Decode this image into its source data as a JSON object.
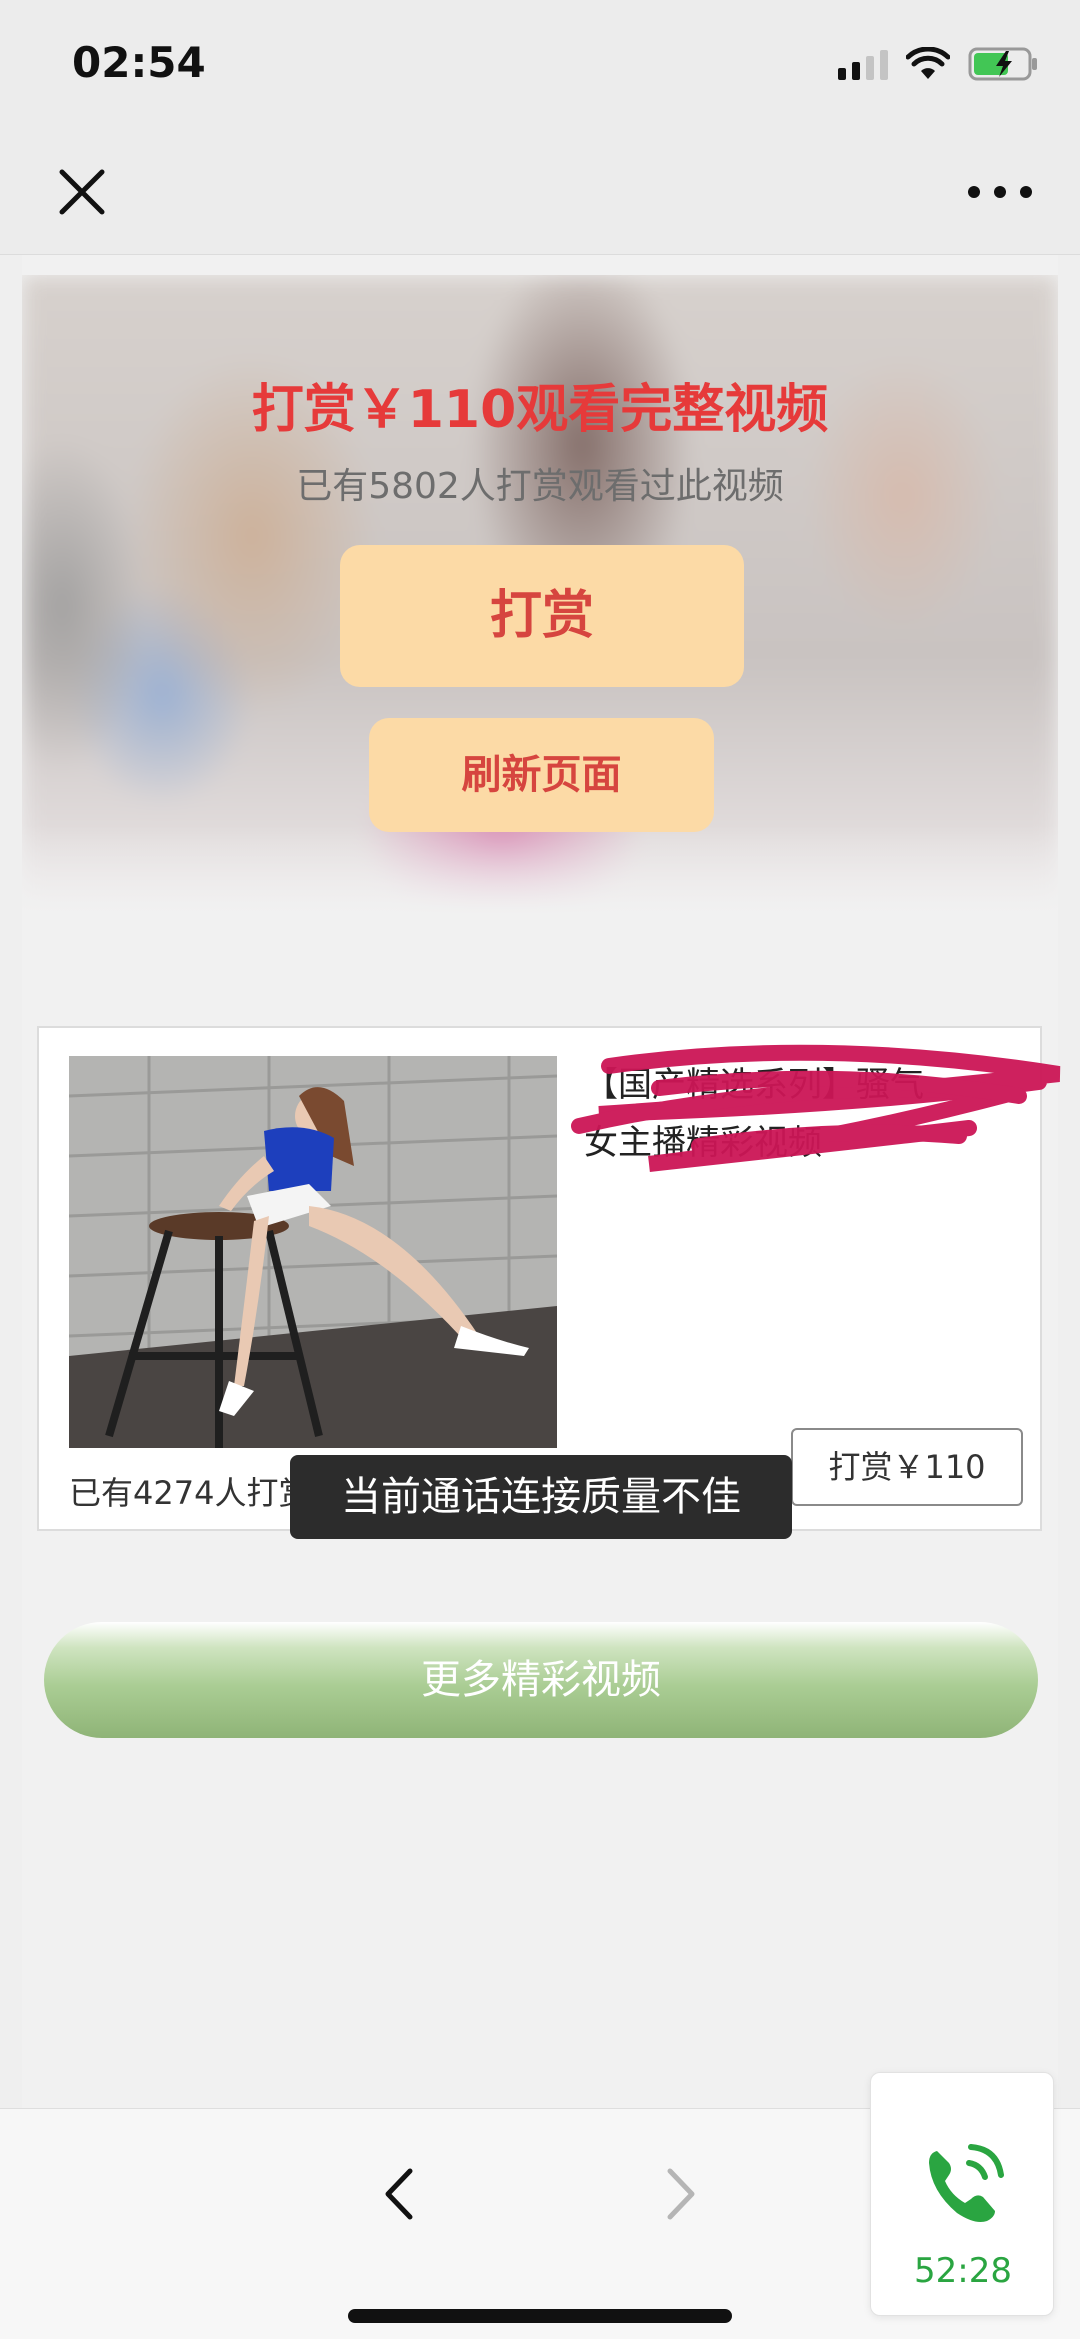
{
  "status_bar": {
    "time": "02:54"
  },
  "nav": {
    "close_icon": "close-icon",
    "more_icon": "more-dots-icon"
  },
  "hero": {
    "title": "打赏￥110观看完整视频",
    "subtitle": "已有5802人打赏观看过此视频",
    "reward_button": "打赏",
    "refresh_button": "刷新页面"
  },
  "card": {
    "title_line1": "【国产精选系列】骚气",
    "title_line2": "女主播精彩视频",
    "price_button": "打赏￥110",
    "count_text": "已有4274人打赏"
  },
  "toast": {
    "text": "当前通话连接质量不佳"
  },
  "more_videos_button": "更多精彩视频",
  "call_widget": {
    "duration": "52:28"
  },
  "colors": {
    "accent_red": "#e63a3a",
    "button_bg": "#fcdaa6",
    "call_green": "#2aa541",
    "more_button_green": "#9fc388"
  }
}
